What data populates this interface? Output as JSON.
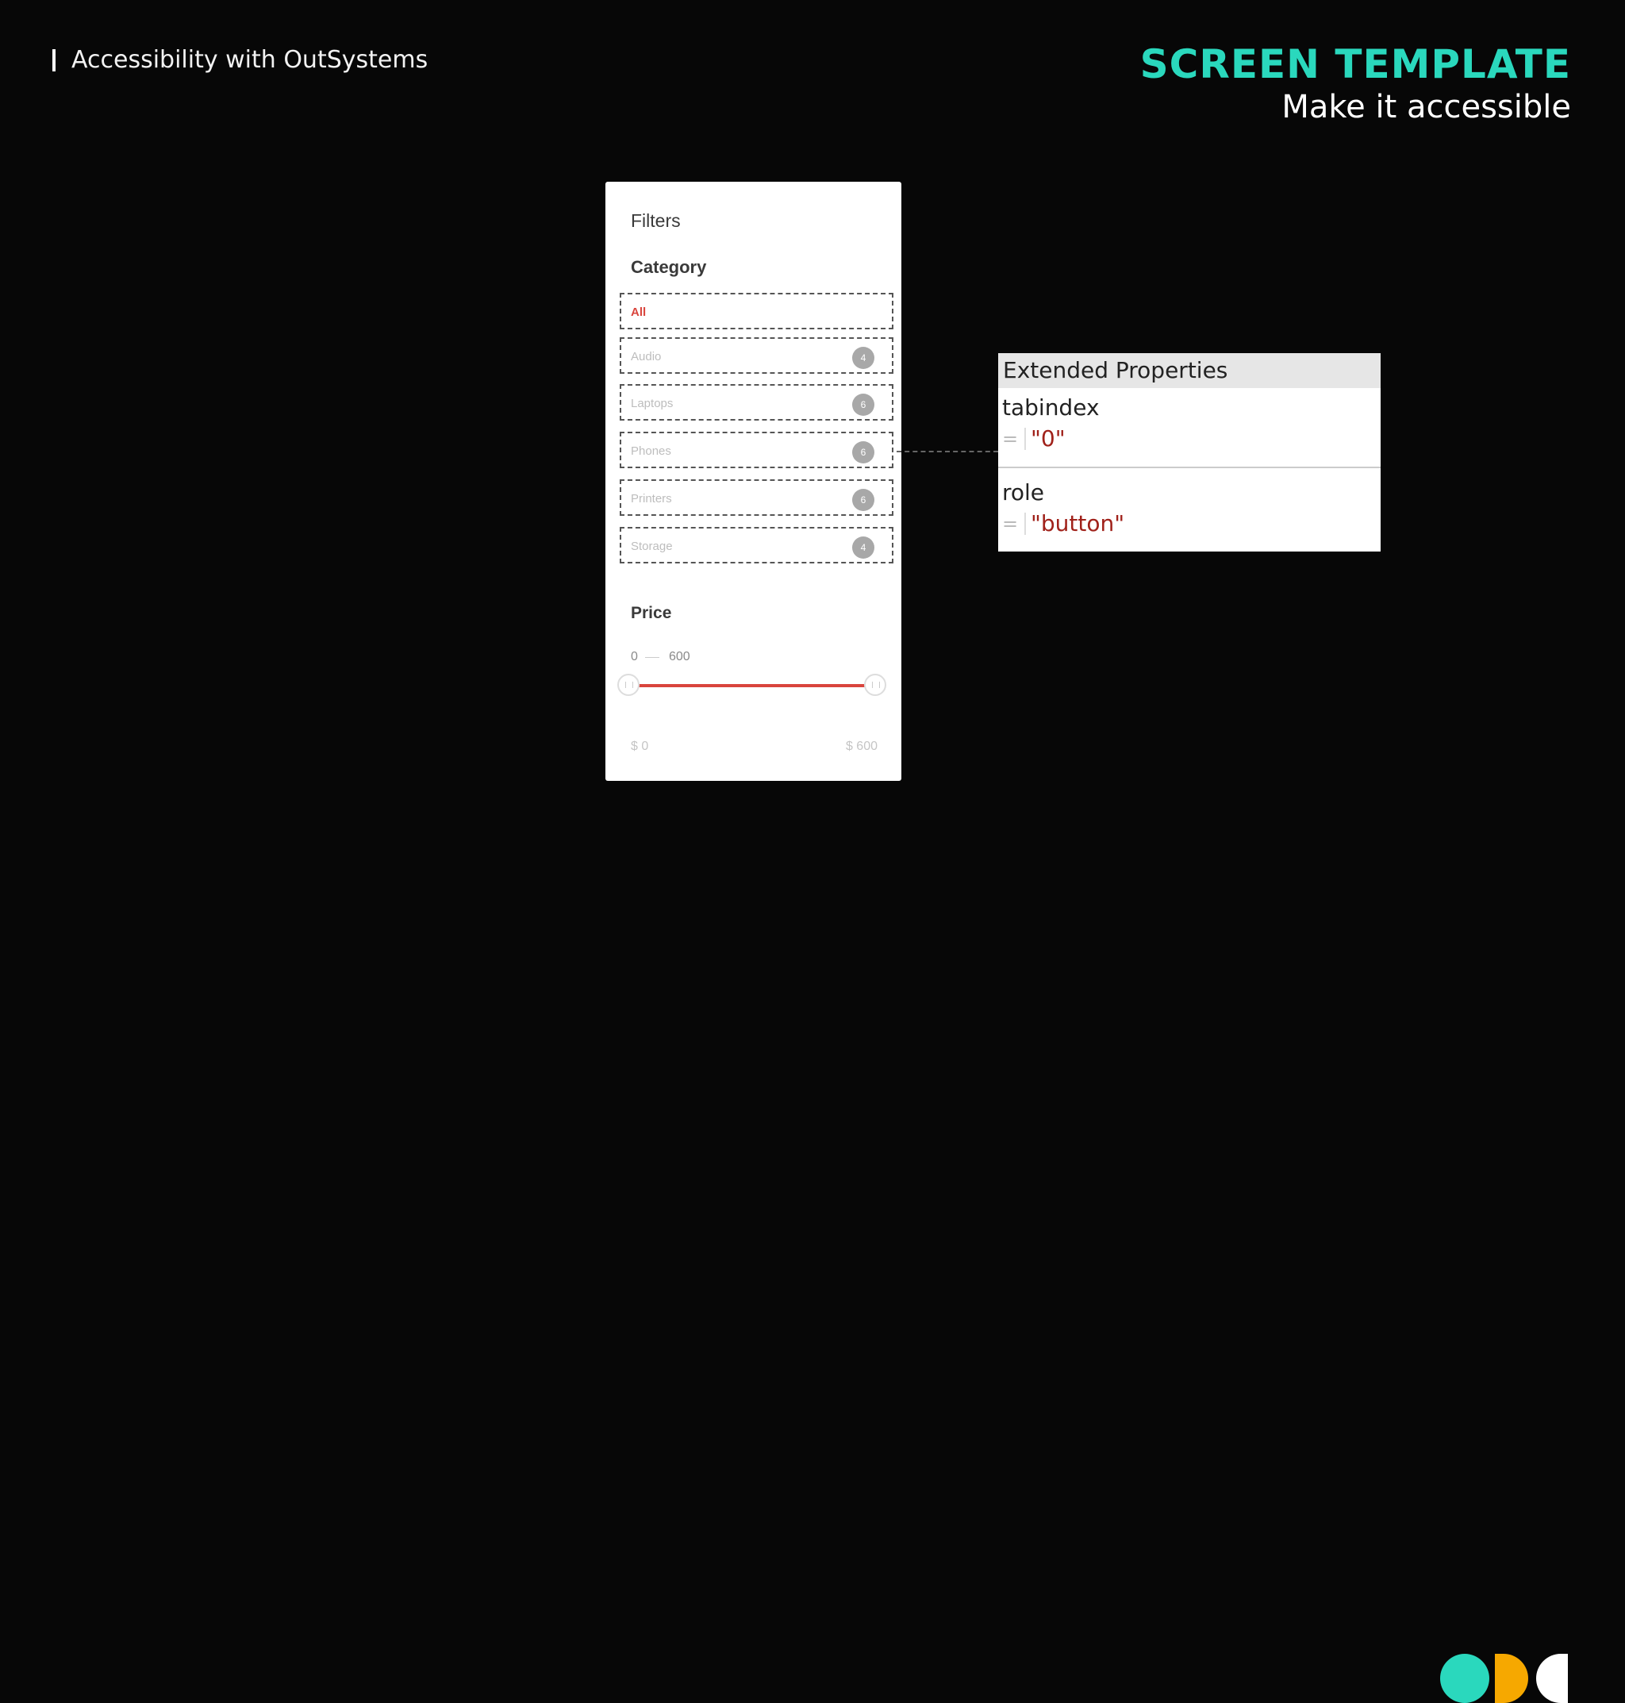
{
  "course_title": "Accessibility with OutSystems",
  "header": {
    "title": "SCREEN TEMPLATE",
    "subtitle": "Make it accessible"
  },
  "filters_panel": {
    "title": "Filters",
    "category_heading": "Category",
    "categories": [
      {
        "label": "All",
        "count": "",
        "active": true
      },
      {
        "label": "Audio",
        "count": "4"
      },
      {
        "label": "Laptops",
        "count": "6"
      },
      {
        "label": "Phones",
        "count": "6"
      },
      {
        "label": "Printers",
        "count": "6"
      },
      {
        "label": "Storage",
        "count": "4"
      }
    ],
    "price_heading": "Price",
    "range_min": "0",
    "range_max": "600",
    "slider_min_label": "$ 0",
    "slider_max_label": "$ 600",
    "accent_color": "#d9453d"
  },
  "extended_properties": {
    "heading": "Extended Properties",
    "items": [
      {
        "name": "tabindex",
        "equals": "=",
        "value": "\"0\""
      },
      {
        "name": "role",
        "equals": "=",
        "value": "\"button\""
      }
    ]
  },
  "colors": {
    "accent_teal": "#2ad8bd",
    "accent_orange": "#f6a800",
    "background": "#070707"
  }
}
